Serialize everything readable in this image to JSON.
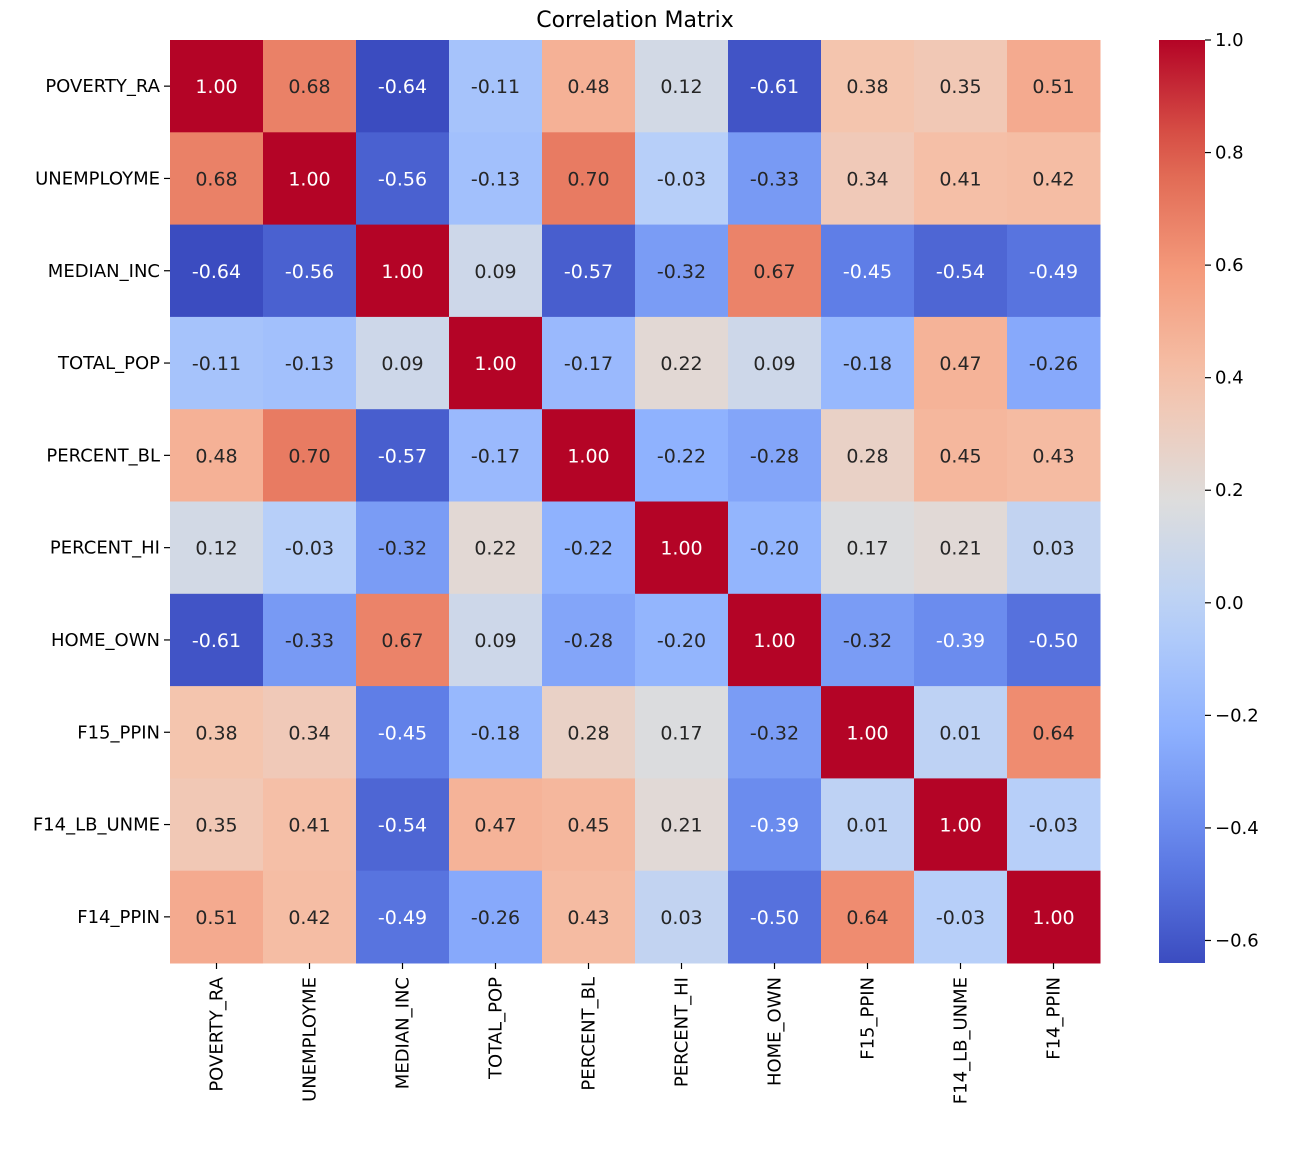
{
  "chart_data": {
    "type": "heatmap",
    "title": "Correlation Matrix",
    "xlabel": "",
    "ylabel": "",
    "labels": [
      "POVERTY_RA",
      "UNEMPLOYME",
      "MEDIAN_INC",
      "TOTAL_POP",
      "PERCENT_BL",
      "PERCENT_HI",
      "HOME_OWN",
      "F15_PPIN",
      "F14_LB_UNME",
      "F14_PPIN"
    ],
    "matrix": [
      [
        1.0,
        0.68,
        -0.64,
        -0.11,
        0.48,
        0.12,
        -0.61,
        0.38,
        0.35,
        0.51
      ],
      [
        0.68,
        1.0,
        -0.56,
        -0.13,
        0.7,
        -0.03,
        -0.33,
        0.34,
        0.41,
        0.42
      ],
      [
        -0.64,
        -0.56,
        1.0,
        0.09,
        -0.57,
        -0.32,
        0.67,
        -0.45,
        -0.54,
        -0.49
      ],
      [
        -0.11,
        -0.13,
        0.09,
        1.0,
        -0.17,
        0.22,
        0.09,
        -0.18,
        0.47,
        -0.26
      ],
      [
        0.48,
        0.7,
        -0.57,
        -0.17,
        1.0,
        -0.22,
        -0.28,
        0.28,
        0.45,
        0.43
      ],
      [
        0.12,
        -0.03,
        -0.32,
        0.22,
        -0.22,
        1.0,
        -0.2,
        0.17,
        0.21,
        0.03
      ],
      [
        -0.61,
        -0.33,
        0.67,
        0.09,
        -0.28,
        -0.2,
        1.0,
        -0.32,
        -0.39,
        -0.5
      ],
      [
        0.38,
        0.34,
        -0.45,
        -0.18,
        0.28,
        0.17,
        -0.32,
        1.0,
        0.01,
        0.64
      ],
      [
        0.35,
        0.41,
        -0.54,
        0.47,
        0.45,
        0.21,
        -0.39,
        0.01,
        1.0,
        -0.03
      ],
      [
        0.51,
        0.42,
        -0.49,
        -0.26,
        0.43,
        0.03,
        -0.5,
        0.64,
        -0.03,
        1.0
      ]
    ],
    "value_format": "0.00",
    "colormap": "coolwarm",
    "vmin": -0.64,
    "vmax": 1.0,
    "colorbar": {
      "ticks": [
        1.0,
        0.8,
        0.6,
        0.4,
        0.2,
        0.0,
        -0.2,
        -0.4,
        -0.6
      ],
      "tick_labels": [
        "1.0",
        "0.8",
        "0.6",
        "0.4",
        "0.2",
        "0.0",
        "−0.2",
        "−0.4",
        "−0.6"
      ],
      "placement": "right"
    },
    "x_tick_rotation": "vertical",
    "grid": false
  }
}
